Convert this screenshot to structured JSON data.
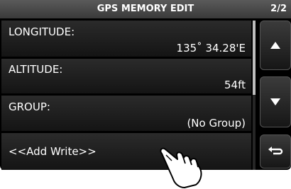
{
  "header": {
    "title": "GPS MEMORY EDIT",
    "page": "2/2"
  },
  "rows": [
    {
      "label": "LONGITUDE:",
      "value": "135˚ 34.28'E"
    },
    {
      "label": "ALTITUDE:",
      "value": "54ft"
    },
    {
      "label": "GROUP:",
      "value": "(No Group)"
    },
    {
      "label": "<<Add Write>>",
      "value": ""
    }
  ],
  "buttons": {
    "up": "up-arrow-icon",
    "down": "down-arrow-icon",
    "back": "return-icon"
  },
  "colors": {
    "background": "#000000",
    "text": "#ffffff",
    "titlebar": "#4a4a4a"
  }
}
